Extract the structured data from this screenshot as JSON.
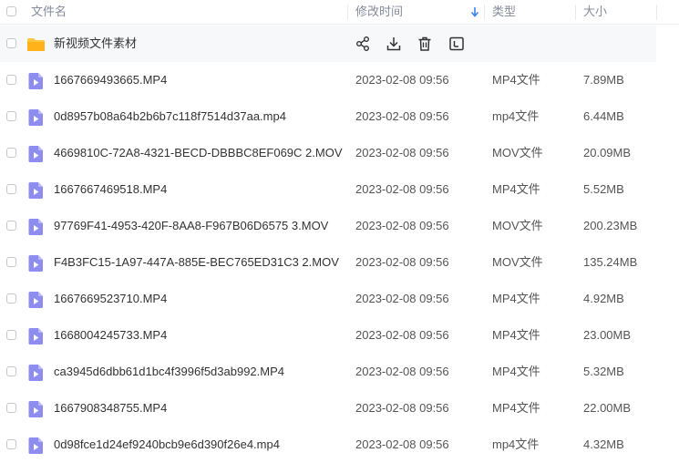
{
  "header": {
    "name_label": "文件名",
    "mtime_label": "修改时间",
    "type_label": "类型",
    "size_label": "大小"
  },
  "colors": {
    "folder": "#ffc53d",
    "file_icon": "#8f8cf0",
    "sort_arrow": "#3b82f6"
  },
  "folder": {
    "name": "新视频文件素材",
    "actions": [
      "share-icon",
      "download-icon",
      "delete-icon",
      "rename-icon"
    ]
  },
  "files": [
    {
      "name": "1667669493665.MP4",
      "mtime": "2023-02-08 09:56",
      "type": "MP4文件",
      "size": "7.89MB"
    },
    {
      "name": "0d8957b08a64b2b6b7c118f7514d37aa.mp4",
      "mtime": "2023-02-08 09:56",
      "type": "mp4文件",
      "size": "6.44MB"
    },
    {
      "name": "4669810C-72A8-4321-BECD-DBBBC8EF069C 2.MOV",
      "mtime": "2023-02-08 09:56",
      "type": "MOV文件",
      "size": "20.09MB"
    },
    {
      "name": "1667667469518.MP4",
      "mtime": "2023-02-08 09:56",
      "type": "MP4文件",
      "size": "5.52MB"
    },
    {
      "name": "97769F41-4953-420F-8AA8-F967B06D6575 3.MOV",
      "mtime": "2023-02-08 09:56",
      "type": "MOV文件",
      "size": "200.23MB"
    },
    {
      "name": "F4B3FC15-1A97-447A-885E-BEC765ED31C3 2.MOV",
      "mtime": "2023-02-08 09:56",
      "type": "MOV文件",
      "size": "135.24MB"
    },
    {
      "name": "1667669523710.MP4",
      "mtime": "2023-02-08 09:56",
      "type": "MP4文件",
      "size": "4.92MB"
    },
    {
      "name": "1668004245733.MP4",
      "mtime": "2023-02-08 09:56",
      "type": "MP4文件",
      "size": "23.00MB"
    },
    {
      "name": "ca3945d6dbb61d1bc4f3996f5d3ab992.MP4",
      "mtime": "2023-02-08 09:56",
      "type": "MP4文件",
      "size": "5.32MB"
    },
    {
      "name": "1667908348755.MP4",
      "mtime": "2023-02-08 09:56",
      "type": "MP4文件",
      "size": "22.00MB"
    },
    {
      "name": "0d98fce1d24ef9240bcb9e6d390f26e4.mp4",
      "mtime": "2023-02-08 09:56",
      "type": "mp4文件",
      "size": "4.32MB"
    }
  ]
}
